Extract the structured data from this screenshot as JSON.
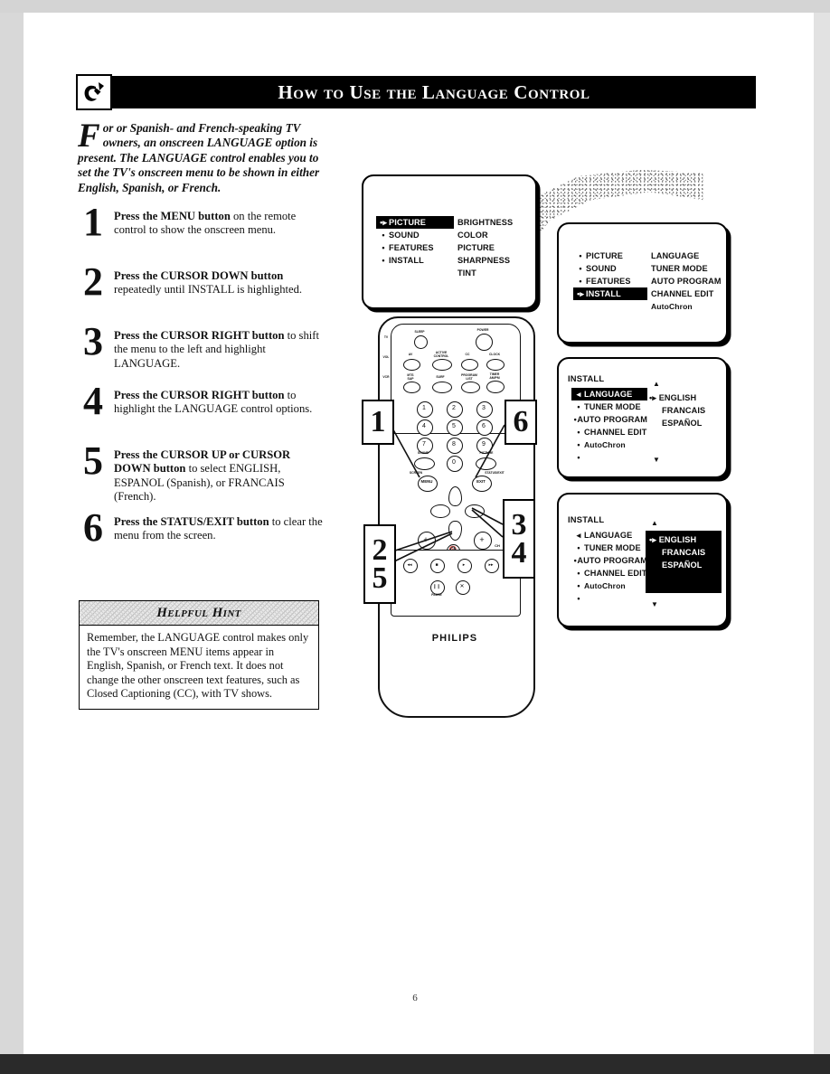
{
  "header": {
    "title": "How to Use the Language Control",
    "icon": "hand-pointer-icon"
  },
  "intro": {
    "dropcap": "F",
    "text": "or or Spanish- and French-speaking TV owners, an onscreen LANGUAGE option is present.  The LANGUAGE control enables you to set the TV's onscreen menu to be shown in either English, Spanish, or French."
  },
  "steps": [
    {
      "num": "1",
      "lead": "Press the MENU button",
      "rest": " on the remote control to show the onscreen menu."
    },
    {
      "num": "2",
      "lead": "Press the CURSOR DOWN button",
      "rest": " repeatedly until INSTALL is highlighted."
    },
    {
      "num": "3",
      "lead": "Press the CURSOR RIGHT button",
      "rest": " to shift the menu to the left and highlight LANGUAGE."
    },
    {
      "num": "4",
      "lead": "Press the CURSOR RIGHT button",
      "rest": " to highlight the LANGUAGE control options."
    },
    {
      "num": "5",
      "lead": "Press the CURSOR UP or CURSOR DOWN button",
      "rest": " to select ENGLISH, ESPANOL (Spanish), or FRANCAIS (French)."
    },
    {
      "num": "6",
      "lead": "Press the STATUS/EXIT button",
      "rest": " to clear the menu from the screen."
    }
  ],
  "hint": {
    "title": "Helpful Hint",
    "body": "Remember, the LANGUAGE control makes only the TV's onscreen MENU items appear in English, Spanish, or French text. It does not change the other onscreen text features, such as Closed Captioning (CC), with TV shows."
  },
  "screens": {
    "screen1": {
      "name": "tv-menu-picture",
      "title": "",
      "menu": [
        {
          "label": "PICTURE",
          "bullet": "•▸",
          "highlighted": true
        },
        {
          "label": "SOUND",
          "bullet": "•",
          "highlighted": false
        },
        {
          "label": "FEATURES",
          "bullet": "•",
          "highlighted": false
        },
        {
          "label": "INSTALL",
          "bullet": "•",
          "highlighted": false
        }
      ],
      "options": [
        "BRIGHTNESS",
        "COLOR",
        "PICTURE",
        "SHARPNESS",
        "TINT"
      ]
    },
    "screen2": {
      "name": "tv-menu-install",
      "title": "",
      "menu": [
        {
          "label": "PICTURE",
          "bullet": "•",
          "highlighted": false
        },
        {
          "label": "SOUND",
          "bullet": "•",
          "highlighted": false
        },
        {
          "label": "FEATURES",
          "bullet": "•",
          "highlighted": false
        },
        {
          "label": "INSTALL",
          "bullet": "•▸",
          "highlighted": true
        }
      ],
      "options": [
        "LANGUAGE",
        "TUNER MODE",
        "AUTO PROGRAM",
        "CHANNEL EDIT",
        "AutoChron"
      ]
    },
    "screen3": {
      "name": "tv-menu-language-highlighted",
      "title": "INSTALL",
      "menu": [
        {
          "label": "LANGUAGE",
          "bullet": "◂",
          "highlighted": true
        },
        {
          "label": "TUNER MODE",
          "bullet": "•",
          "highlighted": false
        },
        {
          "label": "AUTO PROGRAM",
          "bullet": "•",
          "highlighted": false
        },
        {
          "label": "CHANNEL EDIT",
          "bullet": "•",
          "highlighted": false
        },
        {
          "label": "AutoChron",
          "bullet": "•",
          "highlighted": false
        },
        {
          "label": "",
          "bullet": "•",
          "highlighted": false
        }
      ],
      "options": [
        "ENGLISH",
        "FRANCAIS",
        "ESPAÑOL"
      ],
      "option_marker": "•▸",
      "scroll_up": "▲",
      "scroll_down": "▼",
      "options_inverted": false
    },
    "screen4": {
      "name": "tv-menu-language-options-selected",
      "title": "INSTALL",
      "menu": [
        {
          "label": "LANGUAGE",
          "bullet": "◂",
          "highlighted": false
        },
        {
          "label": "TUNER MODE",
          "bullet": "•",
          "highlighted": false
        },
        {
          "label": "AUTO PROGRAM",
          "bullet": "•",
          "highlighted": false
        },
        {
          "label": "CHANNEL EDIT",
          "bullet": "•",
          "highlighted": false
        },
        {
          "label": "AutoChron",
          "bullet": "•",
          "highlighted": false
        },
        {
          "label": "",
          "bullet": "•",
          "highlighted": false
        }
      ],
      "options": [
        "ENGLISH",
        "FRANCAIS",
        "ESPAÑOL"
      ],
      "option_marker": "•▸",
      "scroll_up": "▲",
      "scroll_down": "▼",
      "options_inverted": true
    }
  },
  "remote": {
    "brand": "PHILIPS",
    "top_buttons": [
      {
        "label": "SLEEP",
        "name": "sleep-button"
      },
      {
        "label": "POWER",
        "name": "power-button"
      }
    ],
    "row2_buttons": [
      {
        "label": "AV",
        "name": "av-button"
      },
      {
        "label": "ACTIVE\nCONTROL",
        "name": "active-control-button"
      },
      {
        "label": "CC",
        "name": "cc-button"
      },
      {
        "label": "CLOCK",
        "name": "clock-button"
      }
    ],
    "row3_buttons": [
      {
        "label": "MTS\nSAP",
        "name": "mts-sap-button"
      },
      {
        "label": "SURF",
        "name": "surf-button"
      },
      {
        "label": "PROGRAM\nLIST",
        "name": "program-list-button"
      },
      {
        "label": "TIMER\nAM/PM",
        "name": "timer-button"
      }
    ],
    "side_labels": [
      "TV",
      "VOL",
      "VCR"
    ],
    "keypad": [
      "1",
      "2",
      "3",
      "4",
      "5",
      "6",
      "7",
      "8",
      "9",
      "0"
    ],
    "sound_button": "SOUND",
    "picture_button": "PICTURE",
    "menu_button": "MENU",
    "exit_button": "EXIT",
    "menu_sublabel": "SCREEN",
    "exit_sublabel": "STATUS/EXIT",
    "vol_plus": "+",
    "vol_minus": "−",
    "ch_plus": "+",
    "ch_minus": "−",
    "ch_label": "CH",
    "mute_icon": "mute-icon",
    "transport": [
      "◂◂",
      "■",
      "▸",
      "▸▸"
    ],
    "transport_row2": [
      "❙❙",
      "✕"
    ],
    "pause_label": "PAUSE"
  },
  "callouts": [
    {
      "id": "c1",
      "nums": [
        "1"
      ],
      "target": "menu-button"
    },
    {
      "id": "c6",
      "nums": [
        "6"
      ],
      "target": "exit-button"
    },
    {
      "id": "c25",
      "nums": [
        "2",
        "5"
      ],
      "target": "cursor-down-button"
    },
    {
      "id": "c34",
      "nums": [
        "3",
        "4"
      ],
      "target": "cursor-right-button"
    }
  ],
  "page_number": "6"
}
